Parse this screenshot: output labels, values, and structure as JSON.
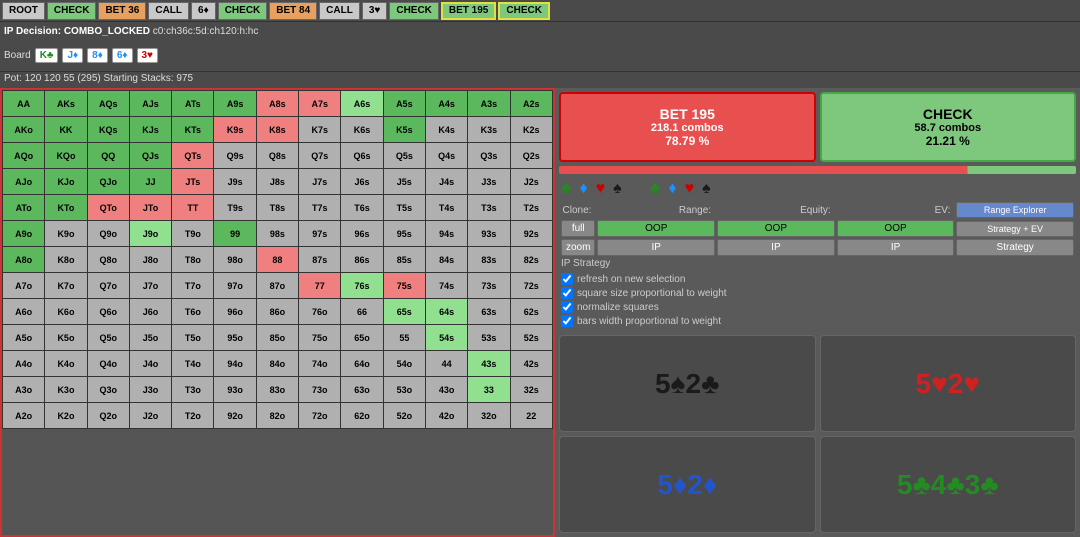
{
  "topNav": {
    "buttons": [
      {
        "label": "ROOT",
        "style": "grey"
      },
      {
        "label": "CHECK",
        "style": "green"
      },
      {
        "label": "BET 36",
        "style": "orange"
      },
      {
        "label": "CALL",
        "style": "grey"
      },
      {
        "label": "6♦",
        "style": "grey"
      },
      {
        "label": "CHECK",
        "style": "green"
      },
      {
        "label": "BET 84",
        "style": "orange"
      },
      {
        "label": "CALL",
        "style": "grey"
      },
      {
        "label": "3♥",
        "style": "grey"
      },
      {
        "label": "CHECK",
        "style": "green"
      },
      {
        "label": "BET 195",
        "style": "highlighted"
      },
      {
        "label": "CHECK",
        "style": "highlighted"
      }
    ]
  },
  "infoBar": {
    "decision": "IP Decision: COMBO_LOCKED",
    "path": "c0:ch36c:5d:ch120:h:hc"
  },
  "board": {
    "label": "Board",
    "cards": [
      {
        "value": "K♣",
        "suit": "clubs"
      },
      {
        "value": "J♦",
        "suit": "diamonds"
      },
      {
        "value": "8♦",
        "suit": "diamonds"
      },
      {
        "value": "6♦",
        "suit": "diamonds"
      },
      {
        "value": "3♥",
        "suit": "hearts"
      }
    ]
  },
  "pot": "Pot: 120  120  55  (295)  Starting Stacks: 975",
  "actions": {
    "bet": {
      "label": "BET 195",
      "combos": "218.1 combos",
      "pct": "78.79 %"
    },
    "check": {
      "label": "CHECK",
      "combos": "58.7 combos",
      "pct": "21.21 %"
    }
  },
  "controls": {
    "cloneLabel": "Clone:",
    "rangeLabel": "Range:",
    "equityLabel": "Equity:",
    "evLabel": "EV:",
    "fullBtn": "full",
    "oopBtn1": "OOP",
    "oopBtn2": "OOP",
    "oopBtn3": "OOP",
    "rangeExplorerBtn": "Range Explorer",
    "zoomBtn": "zoom",
    "ipBtn1": "IP",
    "ipBtn2": "IP",
    "ipBtn3": "IP",
    "strategyEvBtn": "Strategy + EV",
    "strategyBtn": "Strategy",
    "arrowBtn": "<"
  },
  "checkboxes": [
    "refresh on new selection",
    "square size proportional to weight",
    "normalize squares",
    "bars width proportional to weight"
  ],
  "ipStrategy": "IP Strategy",
  "boardDisplay": [
    {
      "text": "5♠2♣",
      "suit": "spades"
    },
    {
      "text": "5♥2♥",
      "suit": "hearts"
    },
    {
      "text": "5♦2♦",
      "suit": "diamonds"
    },
    {
      "text": "5♣4♣3♣",
      "suit": "clubs-green"
    }
  ],
  "matrix": {
    "headers": [
      "AA",
      "AKs",
      "AQs",
      "AJs",
      "ATs",
      "A9s",
      "A8s",
      "A7s",
      "A6s",
      "A5s",
      "A4s",
      "A3s",
      "A2s"
    ],
    "rows": [
      {
        "label": "AA",
        "cells": [
          "AA",
          "AKs",
          "AQs",
          "AJs",
          "ATs",
          "A9s",
          "A8s",
          "A7s",
          "A6s",
          "A5s",
          "A4s",
          "A3s",
          "A2s"
        ]
      },
      {
        "label": "AKo",
        "cells": [
          "AKo",
          "KK",
          "KQs",
          "KJs",
          "KTs",
          "K9s",
          "K8s",
          "K7s",
          "K6s",
          "K5s",
          "K4s",
          "K3s",
          "K2s"
        ]
      },
      {
        "label": "AQo",
        "cells": [
          "AQo",
          "KQo",
          "QQ",
          "QJs",
          "QTs",
          "Q9s",
          "Q8s",
          "Q7s",
          "Q6s",
          "Q5s",
          "Q4s",
          "Q3s",
          "Q2s"
        ]
      },
      {
        "label": "AJo",
        "cells": [
          "AJo",
          "KJo",
          "QJo",
          "JJ",
          "JTs",
          "J9s",
          "J8s",
          "J7s",
          "J6s",
          "J5s",
          "J4s",
          "J3s",
          "J2s"
        ]
      },
      {
        "label": "ATo",
        "cells": [
          "ATo",
          "KTo",
          "QTo",
          "JTo",
          "TT",
          "T9s",
          "T8s",
          "T7s",
          "T6s",
          "T5s",
          "T4s",
          "T3s",
          "T2s"
        ]
      },
      {
        "label": "A9o",
        "cells": [
          "A9o",
          "K9o",
          "Q9o",
          "J9o",
          "T9o",
          "99",
          "98s",
          "97s",
          "96s",
          "95s",
          "94s",
          "93s",
          "92s"
        ]
      },
      {
        "label": "A8o",
        "cells": [
          "A8o",
          "K8o",
          "Q8o",
          "J8o",
          "T8o",
          "98o",
          "88",
          "87s",
          "86s",
          "85s",
          "84s",
          "83s",
          "82s"
        ]
      },
      {
        "label": "A7o",
        "cells": [
          "A7o",
          "K7o",
          "Q7o",
          "J7o",
          "T7o",
          "97o",
          "87o",
          "77",
          "76s",
          "75s",
          "74s",
          "73s",
          "72s"
        ]
      },
      {
        "label": "A6o",
        "cells": [
          "A6o",
          "K6o",
          "Q6o",
          "J6o",
          "T6o",
          "96o",
          "86o",
          "76o",
          "66",
          "65s",
          "64s",
          "63s",
          "62s"
        ]
      },
      {
        "label": "A5o",
        "cells": [
          "A5o",
          "K5o",
          "Q5o",
          "J5o",
          "T5o",
          "95o",
          "85o",
          "75o",
          "65o",
          "55",
          "54s",
          "53s",
          "52s"
        ]
      },
      {
        "label": "A4o",
        "cells": [
          "A4o",
          "K4o",
          "Q4o",
          "J4o",
          "T4o",
          "94o",
          "84o",
          "74o",
          "64o",
          "54o",
          "44",
          "43s",
          "42s"
        ]
      },
      {
        "label": "A3o",
        "cells": [
          "A3o",
          "K3o",
          "Q3o",
          "J3o",
          "T3o",
          "93o",
          "83o",
          "73o",
          "63o",
          "53o",
          "43o",
          "33",
          "32s"
        ]
      },
      {
        "label": "A2o",
        "cells": [
          "A2o",
          "K2o",
          "Q2o",
          "J2o",
          "T2o",
          "92o",
          "82o",
          "72o",
          "62o",
          "52o",
          "42o",
          "32o",
          "22"
        ]
      }
    ]
  }
}
